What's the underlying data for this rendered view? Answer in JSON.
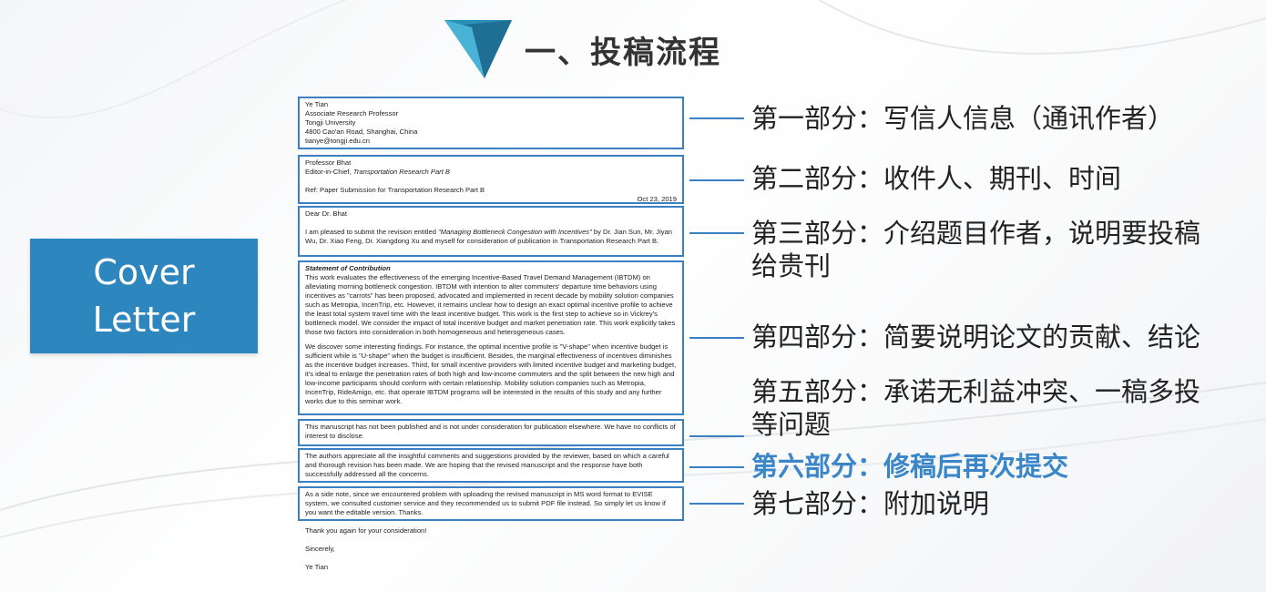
{
  "slide": {
    "title": "一、投稿流程",
    "cover_label_line1": "Cover",
    "cover_label_line2": "Letter",
    "colors": {
      "accent": "#2e86bf",
      "highlight": "#3a86c8",
      "frame": "#3a80c2"
    }
  },
  "letter": {
    "sender": [
      "Ye Tian",
      "Associate Research Professor",
      "Tongji University",
      "4800 Cao'an Road, Shanghai, China",
      "tianye@tongji.edu.cn"
    ],
    "recipient_name": "Professor Bhat",
    "recipient_role_prefix": "Editor-in-Chief, ",
    "recipient_journal": "Transportation Research Part B",
    "ref": "Ref: Paper Submission for Transportation Research Part B",
    "date": "Oct 23, 2019",
    "salutation": "Dear Dr. Bhat",
    "intro_a": "I am pleased to submit the revision entitled ",
    "intro_title": "\"Managing Bottleneck Congestion with Incentives\"",
    "intro_b": " by Dr. Jian Sun, Mr. Jiyan Wu, Dr. Xiao Feng, Dr. Xiangdong Xu and myself for consideration of publication in Transportation Research Part B.",
    "contrib_heading": "Statement of Contribution",
    "contrib_p1": "This work evaluates the effectiveness of the emerging Incentive-Based Travel Demand Management (IBTDM) on alleviating morning bottleneck congestion. IBTDM with intention to alter commuters' departure time behaviors using incentives as \"carrots\" has been proposed, advocated and implemented in recent decade by mobility solution companies such as Metropia, IncenTrip, etc. However, it remains unclear how to design an exact optimal incentive profile to achieve the least total system travel time with the least incentive budget. This work is the first step to achieve so in Vickrey's bottleneck model. We consider the impact of total incentive budget and market penetration rate. This work explicitly takes those two factors into consideration in both homogeneous and heterogeneous cases.",
    "contrib_p2": "We discover some interesting findings. For instance, the optimal incentive profile is \"V-shape\" when incentive budget is sufficient while is \"U-shape\" when the budget is insufficient. Besides, the marginal effectiveness of incentives diminishes as the incentive budget increases. Third, for small incentive providers with limited incentive budget and marketing budget, it's ideal to enlarge the penetration rates of both high and low-income commuters and the split between the new high and low-income participants should conform with certain relationship. Mobility solution companies such as Metropia, IncenTrip, RideAmigo, etc. that operate IBTDM programs will be interested in the results of this study and any further works due to this seminar work.",
    "no_conflict": "This manuscript has not been published and is not under consideration for publication elsewhere.  We have no conflicts of interest to disclose.",
    "revision": "The authors appreciate all the insightful comments and suggestions provided by the reviewer, based on which a careful and thorough revision has been made. We are hoping that the revised manuscript and the response have both successfully addressed all the concerns.",
    "side_note": "As a side note, since we encountered problem with uploading the revised manuscript in MS word format to EVISE system, we consulted customer service and they recommended us to submit PDF file instead. So simply let us know if you want the editable version. Thanks.",
    "thanks": "Thank you again for your consideration!",
    "closing": "Sincerely,",
    "signature": "Ye Tian"
  },
  "parts": [
    {
      "line1": "第一部分：写信人信息（通讯作者）",
      "line2": ""
    },
    {
      "line1": "第二部分：收件人、期刊、时间",
      "line2": ""
    },
    {
      "line1": "第三部分：介绍题目作者，说明要投稿",
      "line2": "给贵刊"
    },
    {
      "line1": "第四部分：简要说明论文的贡献、结论",
      "line2": ""
    },
    {
      "line1": "第五部分：承诺无利益冲突、一稿多投",
      "line2": "等问题"
    },
    {
      "line1": "第六部分：修稿后再次提交",
      "line2": ""
    },
    {
      "line1": "第七部分：附加说明",
      "line2": ""
    }
  ]
}
